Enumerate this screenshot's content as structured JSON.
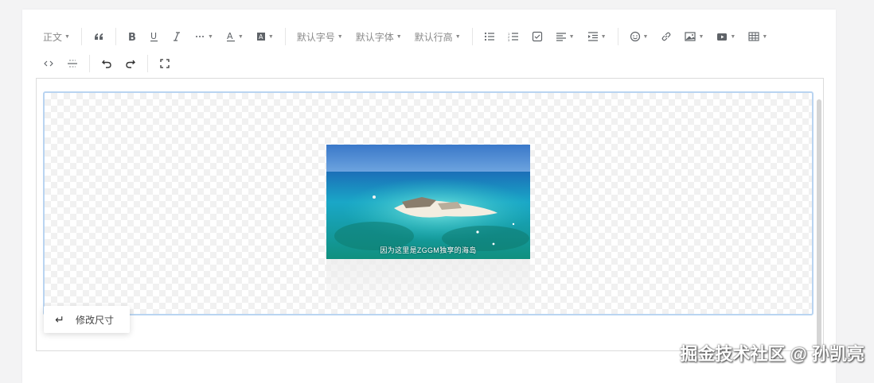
{
  "toolbar": {
    "row1": [
      {
        "name": "paragraph-style-dropdown",
        "label": "正文",
        "caret": true
      },
      {
        "sep": true
      },
      {
        "name": "quote-button",
        "icon": "quote-icon"
      },
      {
        "sep": true
      },
      {
        "name": "bold-button",
        "icon": "bold-icon"
      },
      {
        "name": "underline-button",
        "icon": "underline-icon"
      },
      {
        "name": "italic-button",
        "icon": "italic-icon"
      },
      {
        "name": "more-styles-dropdown",
        "icon": "ellipsis-icon",
        "caret": true
      },
      {
        "name": "font-color-dropdown",
        "icon": "font-color-icon",
        "caret": true
      },
      {
        "name": "background-color-dropdown",
        "icon": "background-color-icon",
        "caret": true
      },
      {
        "sep": true
      },
      {
        "name": "font-size-dropdown",
        "label": "默认字号",
        "caret": true
      },
      {
        "name": "font-family-dropdown",
        "label": "默认字体",
        "caret": true
      },
      {
        "name": "line-height-dropdown",
        "label": "默认行高",
        "caret": true
      },
      {
        "sep": true
      },
      {
        "name": "bulleted-list-button",
        "icon": "bulleted-list-icon"
      },
      {
        "name": "numbered-list-button",
        "icon": "numbered-list-icon"
      },
      {
        "name": "todo-button",
        "icon": "checkbox-icon"
      },
      {
        "name": "align-dropdown",
        "icon": "align-left-icon",
        "caret": true
      },
      {
        "name": "indent-dropdown",
        "icon": "indent-icon",
        "caret": true
      },
      {
        "sep": true
      },
      {
        "name": "emoji-dropdown",
        "icon": "emoji-icon",
        "caret": true
      },
      {
        "name": "link-button",
        "icon": "link-icon"
      },
      {
        "name": "image-dropdown",
        "icon": "image-icon",
        "caret": true
      },
      {
        "name": "video-dropdown",
        "icon": "video-icon",
        "caret": true
      },
      {
        "name": "table-dropdown",
        "icon": "table-icon",
        "caret": true
      }
    ],
    "row2": [
      {
        "name": "code-button",
        "icon": "code-icon"
      },
      {
        "name": "divider-button",
        "icon": "divider-icon"
      },
      {
        "sep": true
      },
      {
        "name": "undo-button",
        "icon": "undo-icon"
      },
      {
        "name": "redo-button",
        "icon": "redo-icon"
      },
      {
        "sep": true
      },
      {
        "name": "fullscreen-button",
        "icon": "fullscreen-icon"
      }
    ]
  },
  "editor": {
    "video_caption": "因为这里是ZGGM独享的海岛",
    "resize_label": "修改尺寸",
    "resize_icon": "enter-icon"
  },
  "watermark": "掘金技术社区 @ 孙凯亮",
  "colors": {
    "accent_border": "#b9d4f1",
    "toolbar_icon": "#5f6368"
  }
}
